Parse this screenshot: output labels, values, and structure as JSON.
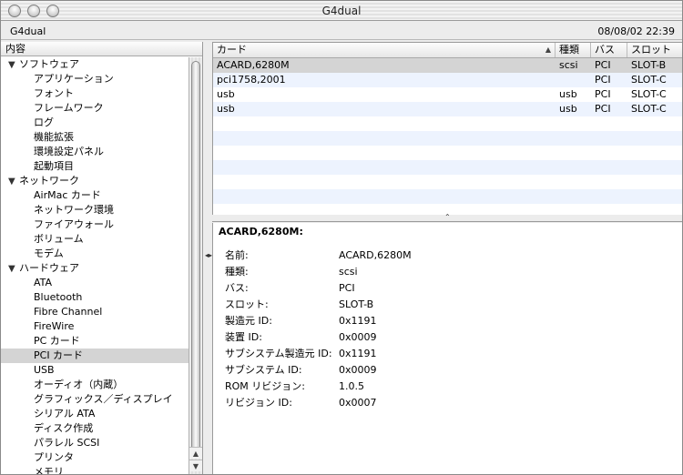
{
  "window": {
    "title": "G4dual"
  },
  "infobar": {
    "machine_name": "G4dual",
    "datetime": "08/08/02 22:39"
  },
  "sidebar": {
    "header": "内容",
    "groups": [
      {
        "label": "ソフトウェア",
        "items": [
          {
            "label": "アプリケーション"
          },
          {
            "label": "フォント"
          },
          {
            "label": "フレームワーク"
          },
          {
            "label": "ログ"
          },
          {
            "label": "機能拡張"
          },
          {
            "label": "環境設定パネル"
          },
          {
            "label": "起動項目"
          }
        ]
      },
      {
        "label": "ネットワーク",
        "items": [
          {
            "label": "AirMac カード"
          },
          {
            "label": "ネットワーク環境"
          },
          {
            "label": "ファイアウォール"
          },
          {
            "label": "ボリューム"
          },
          {
            "label": "モデム"
          }
        ]
      },
      {
        "label": "ハードウェア",
        "items": [
          {
            "label": "ATA"
          },
          {
            "label": "Bluetooth"
          },
          {
            "label": "Fibre Channel"
          },
          {
            "label": "FireWire"
          },
          {
            "label": "PC カード"
          },
          {
            "label": "PCI カード"
          },
          {
            "label": "USB"
          },
          {
            "label": "オーディオ（内蔵）"
          },
          {
            "label": "グラフィックス／ディスプレイ"
          },
          {
            "label": "シリアル ATA"
          },
          {
            "label": "ディスク作成"
          },
          {
            "label": "パラレル SCSI"
          },
          {
            "label": "プリンタ"
          },
          {
            "label": "メモリ"
          }
        ]
      }
    ],
    "selected": "PCI カード",
    "disclosure_icon": "triangle-down-icon"
  },
  "table": {
    "columns": [
      "カード",
      "種類",
      "バス",
      "スロット"
    ],
    "sort_icon": "sort-ascending-icon",
    "rows": [
      {
        "card": "ACARD,6280M",
        "type": "scsi",
        "bus": "PCI",
        "slot": "SLOT-B"
      },
      {
        "card": "pci1758,2001",
        "type": "",
        "bus": "PCI",
        "slot": "SLOT-C"
      },
      {
        "card": "usb",
        "type": "usb",
        "bus": "PCI",
        "slot": "SLOT-C"
      },
      {
        "card": "usb",
        "type": "usb",
        "bus": "PCI",
        "slot": "SLOT-C"
      }
    ]
  },
  "detail": {
    "title": "ACARD,6280M:",
    "fields": [
      {
        "key": "名前:",
        "value": "ACARD,6280M"
      },
      {
        "key": "種類:",
        "value": "scsi"
      },
      {
        "key": "バス:",
        "value": "PCI"
      },
      {
        "key": "スロット:",
        "value": "SLOT-B"
      },
      {
        "key": "製造元 ID:",
        "value": "0x1191"
      },
      {
        "key": "装置 ID:",
        "value": "0x0009"
      },
      {
        "key": "サブシステム製造元 ID:",
        "value": "0x1191"
      },
      {
        "key": "サブシステム ID:",
        "value": "0x0009"
      },
      {
        "key": "ROM リビジョン:",
        "value": "1.0.5"
      },
      {
        "key": "リビジョン ID:",
        "value": "0x0007"
      }
    ]
  }
}
